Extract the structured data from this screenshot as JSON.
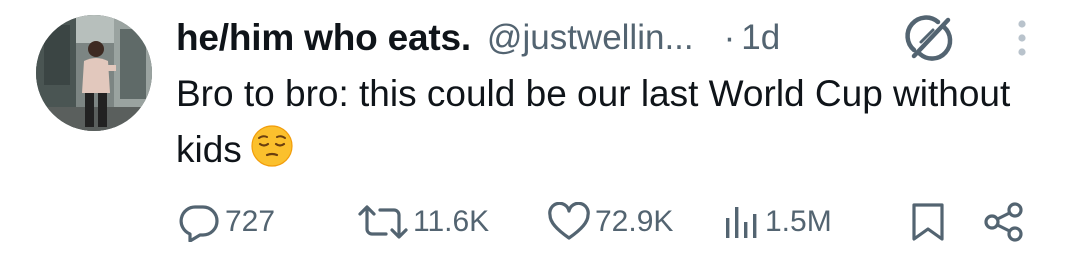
{
  "tweet": {
    "author": {
      "display_name": "he/him who eats.",
      "handle": "@justwellin...",
      "avatar_icon": "profile-photo"
    },
    "separator": "·",
    "time": "1d",
    "text": "Bro to bro: this could be our last World Cup without kids",
    "emoji": "pensive-face-emoji",
    "header_icons": [
      "grok-icon",
      "more-options-icon"
    ],
    "actions": {
      "replies": {
        "icon": "reply-icon",
        "count": "727"
      },
      "reposts": {
        "icon": "repost-icon",
        "count": "11.6K"
      },
      "likes": {
        "icon": "like-icon",
        "count": "72.9K"
      },
      "views": {
        "icon": "views-icon",
        "count": "1.5M"
      },
      "bookmark": {
        "icon": "bookmark-icon"
      },
      "share": {
        "icon": "share-icon"
      }
    },
    "colors": {
      "text": "#0f1419",
      "secondary": "#536471",
      "icon_light": "#b9c3cc"
    }
  }
}
